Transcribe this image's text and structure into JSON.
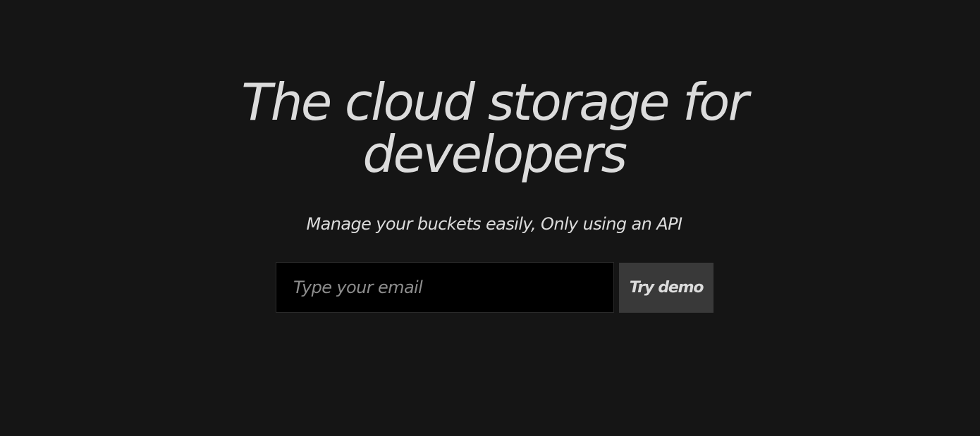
{
  "hero": {
    "headline_line1": "The cloud storage for",
    "headline_line2": "developers",
    "subtitle": "Manage your buckets easily, Only using an API"
  },
  "signup": {
    "email_placeholder": "Type your email",
    "email_value": "",
    "button_label": "Try demo"
  },
  "colors": {
    "background": "#151515",
    "text": "#dcdcdc",
    "input_background": "#000000",
    "button_background": "#393939"
  }
}
